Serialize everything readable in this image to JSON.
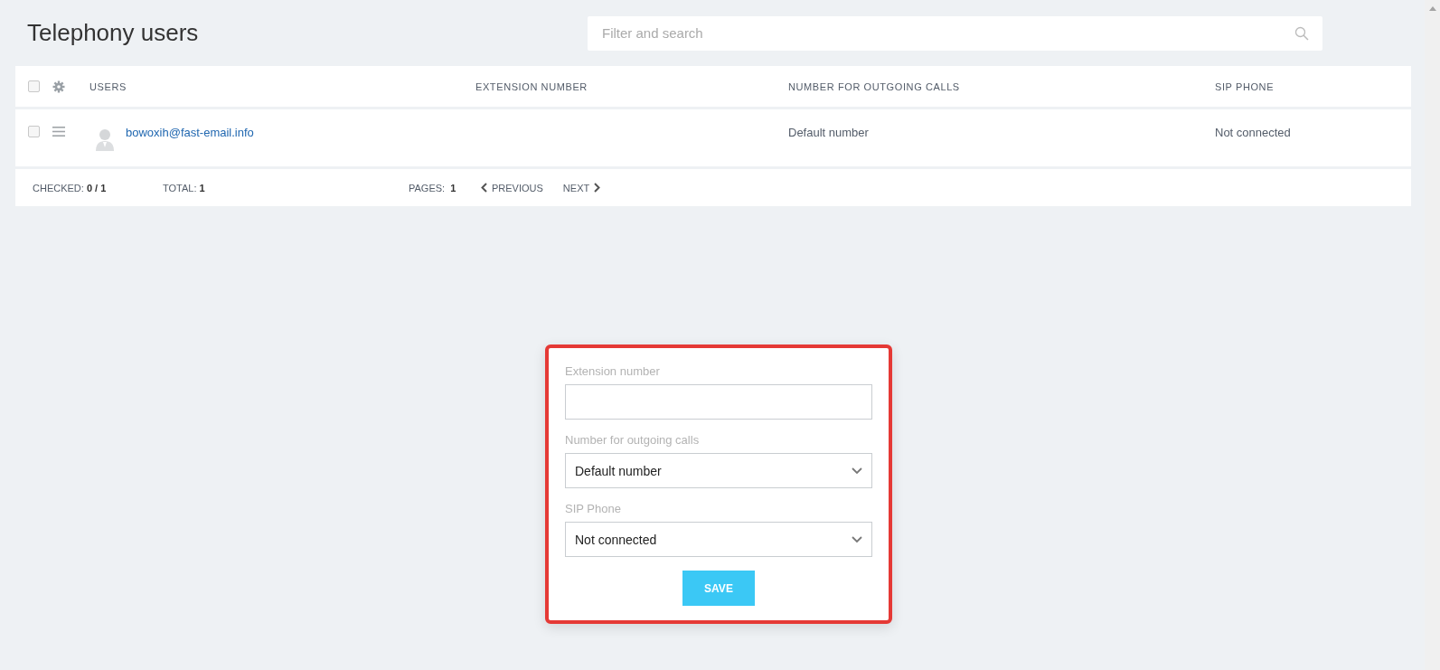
{
  "title": "Telephony users",
  "search": {
    "placeholder": "Filter and search"
  },
  "table": {
    "header_checked": false,
    "columns": [
      "USERS",
      "EXTENSION NUMBER",
      "NUMBER FOR OUTGOING CALLS",
      "SIP PHONE"
    ],
    "rows": [
      {
        "checked": false,
        "user": "bowoxih@fast-email.info",
        "outgoing_number": "Default number",
        "sip_phone": "Not connected"
      }
    ]
  },
  "footer": {
    "checked_label": "CHECKED:",
    "checked_value": "0 / 1",
    "total_label": "TOTAL:",
    "total_value": "1",
    "pages_label": "PAGES:",
    "pages_value": "1",
    "previous": "PREVIOUS",
    "next": "NEXT"
  },
  "dialog": {
    "fields": [
      {
        "kind": "text",
        "label": "Extension number"
      },
      {
        "kind": "select",
        "label": "Number for outgoing calls",
        "value": "Default number"
      },
      {
        "kind": "select",
        "label": "SIP Phone",
        "value": "Not connected"
      }
    ],
    "save": "SAVE"
  }
}
